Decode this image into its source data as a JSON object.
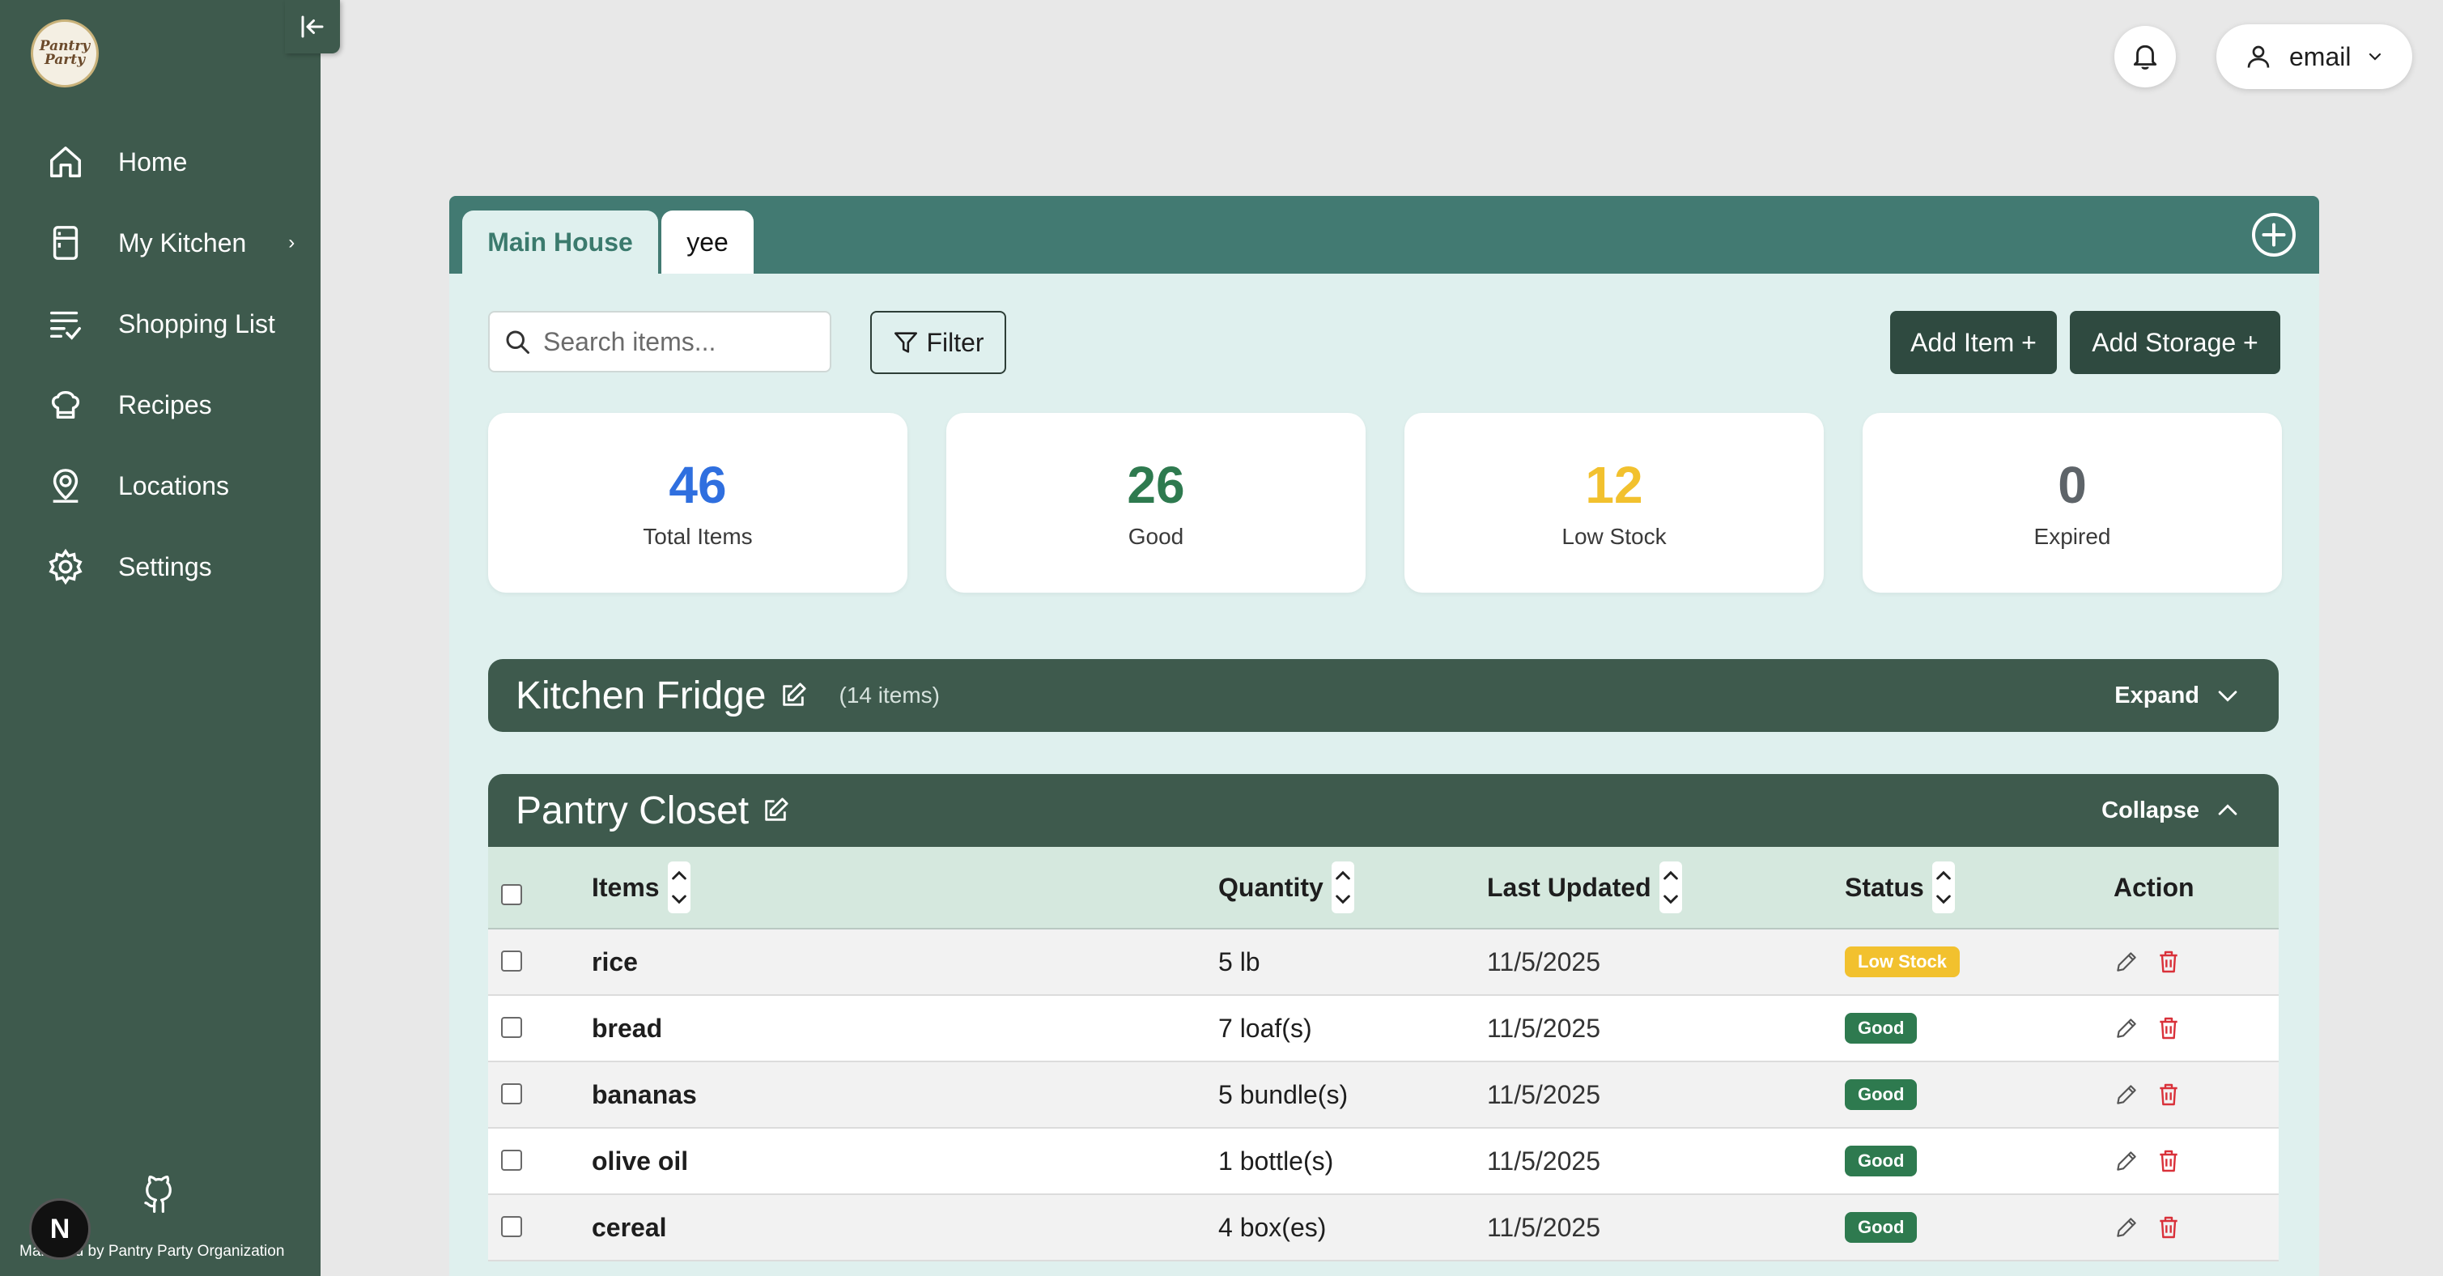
{
  "sidebar": {
    "logo_text": "Pantry Party",
    "items": [
      {
        "label": "Home",
        "icon": "home-icon"
      },
      {
        "label": "My Kitchen",
        "icon": "fridge-icon",
        "chevron": "›"
      },
      {
        "label": "Shopping List",
        "icon": "list-check-icon"
      },
      {
        "label": "Recipes",
        "icon": "chef-hat-icon"
      },
      {
        "label": "Locations",
        "icon": "location-user-icon"
      },
      {
        "label": "Settings",
        "icon": "gear-icon"
      }
    ],
    "footer": "Managed by Pantry Party Organization",
    "n_badge": "N"
  },
  "header": {
    "user_label": "email"
  },
  "tabs": [
    {
      "label": "Main House",
      "active": true
    },
    {
      "label": "yee",
      "active": false
    }
  ],
  "toolbar": {
    "search_placeholder": "Search items...",
    "filter_label": "Filter",
    "add_item_label": "Add Item +",
    "add_storage_label": "Add Storage +"
  },
  "stats": [
    {
      "value": "46",
      "label": "Total Items",
      "color": "#2f6fdf"
    },
    {
      "value": "26",
      "label": "Good",
      "color": "#2e7a4f"
    },
    {
      "value": "12",
      "label": "Low Stock",
      "color": "#f2c12e"
    },
    {
      "value": "0",
      "label": "Expired",
      "color": "#5e6469"
    }
  ],
  "storages": [
    {
      "name": "Kitchen Fridge",
      "count": "(14 items)",
      "toggle": "Expand"
    },
    {
      "name": "Pantry Closet",
      "toggle": "Collapse"
    }
  ],
  "table": {
    "headers": {
      "items": "Items",
      "quantity": "Quantity",
      "last_updated": "Last Updated",
      "status": "Status",
      "action": "Action"
    },
    "rows": [
      {
        "name": "rice",
        "quantity": "5 lb",
        "updated": "11/5/2025",
        "status": "Low Stock",
        "status_type": "low"
      },
      {
        "name": "bread",
        "quantity": "7 loaf(s)",
        "updated": "11/5/2025",
        "status": "Good",
        "status_type": "good"
      },
      {
        "name": "bananas",
        "quantity": "5 bundle(s)",
        "updated": "11/5/2025",
        "status": "Good",
        "status_type": "good"
      },
      {
        "name": "olive oil",
        "quantity": "1 bottle(s)",
        "updated": "11/5/2025",
        "status": "Good",
        "status_type": "good"
      },
      {
        "name": "cereal",
        "quantity": "4 box(es)",
        "updated": "11/5/2025",
        "status": "Good",
        "status_type": "good"
      }
    ]
  },
  "colors": {
    "sidebar": "#3e5a4d",
    "tabbar": "#427a72",
    "panel": "#dff0ee",
    "accent_dark": "#2f4a40"
  }
}
